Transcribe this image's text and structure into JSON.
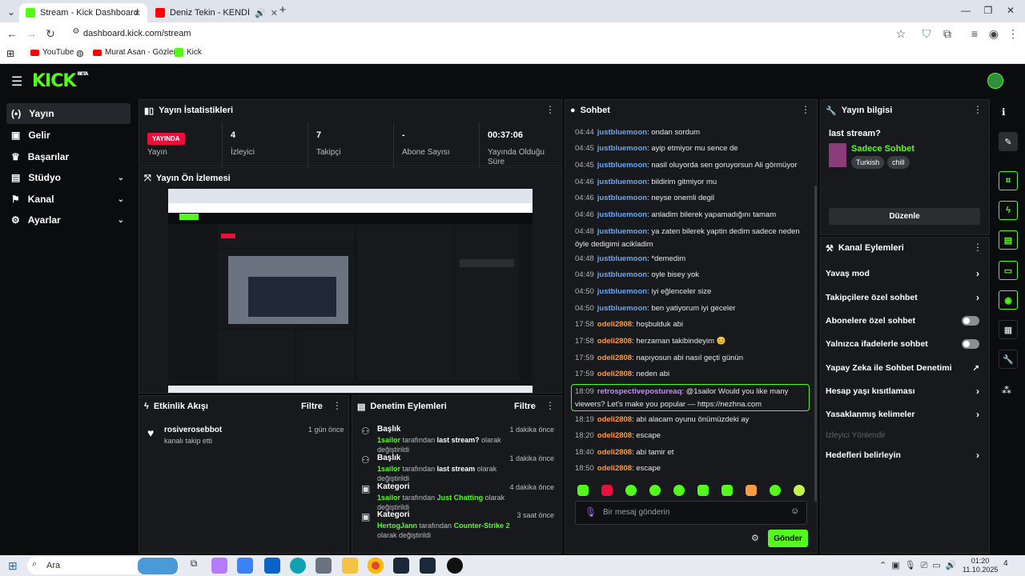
{
  "browser": {
    "tabs": [
      {
        "label": "Stream - Kick Dashboard"
      },
      {
        "label": "Deniz Tekin - KENDİNE İYİ B..."
      }
    ],
    "url": "dashboard.kick.com/stream",
    "bookmarks": [
      "YouTube",
      "Murat Asan - Gözler...",
      "Kick"
    ]
  },
  "app": {
    "logo": "KICK",
    "logo_badge": "BETA"
  },
  "sidebar": {
    "items": [
      {
        "label": "Yayın",
        "icon": "broadcast-icon"
      },
      {
        "label": "Gelir",
        "icon": "wallet-icon"
      },
      {
        "label": "Başarılar",
        "icon": "trophy-icon"
      },
      {
        "label": "Stüdyo",
        "icon": "studio-icon"
      },
      {
        "label": "Kanal",
        "icon": "channel-icon"
      },
      {
        "label": "Ayarlar",
        "icon": "gear-icon"
      }
    ]
  },
  "stats": {
    "title": "Yayın İstatistikleri",
    "live_badge": "YAYINDA",
    "items": [
      {
        "value": "",
        "label": "Yayın"
      },
      {
        "value": "4",
        "label": "İzleyici"
      },
      {
        "value": "7",
        "label": "Takipçi"
      },
      {
        "value": "-",
        "label": "Abone Sayısı"
      },
      {
        "value": "00:37:06",
        "label": "Yayında Olduğu Süre"
      }
    ]
  },
  "preview": {
    "title": "Yayın Ön İzlemesi"
  },
  "activity": {
    "title": "Etkinlik Akışı",
    "filter": "Filtre",
    "items": [
      {
        "user": "rosiverosebbot",
        "text": "kanalı takip etti",
        "time": "1 gün önce"
      }
    ]
  },
  "mod": {
    "title": "Denetim Eylemleri",
    "filter": "Filtre",
    "items": [
      {
        "title": "Başlık",
        "user": "1sailor",
        "mid": "tarafından",
        "value": "last stream?",
        "tail": "olarak değiştirildi",
        "time": "1 dakika önce"
      },
      {
        "title": "Başlık",
        "user": "1sailor",
        "mid": "tarafından",
        "value": "last stream",
        "tail": "olarak değiştirildi",
        "time": "1 dakika önce"
      },
      {
        "title": "Kategori",
        "user": "1sailor",
        "mid": "tarafından",
        "value": "Just Chatting",
        "tail": "olarak değiştirildi",
        "time": "4 dakika önce"
      },
      {
        "title": "Kategori",
        "user": "HertogJann",
        "mid": "tarafından",
        "value": "Counter-Strike 2",
        "tail": "olarak değiştirildi",
        "time": "3 saat önce"
      }
    ]
  },
  "chat": {
    "title": "Sohbet",
    "placeholder": "Bir mesaj gönderin",
    "send": "Gönder",
    "messages": [
      {
        "time": "04:44",
        "user": "justbluemoon",
        "text": "ondan sordum",
        "color": "blue"
      },
      {
        "time": "04:45",
        "user": "justbluemoon",
        "text": "ayip etmiyor mu sence de",
        "color": "blue"
      },
      {
        "time": "04:45",
        "user": "justbluemoon",
        "text": "nasil oluyorda sen goruyorsun Ali görmüyor",
        "color": "blue"
      },
      {
        "time": "04:46",
        "user": "justbluemoon",
        "text": "bildirim gitmiyor mu",
        "color": "blue"
      },
      {
        "time": "04:46",
        "user": "justbluemoon",
        "text": "neyse onemli degil",
        "color": "blue"
      },
      {
        "time": "04:46",
        "user": "justbluemoon",
        "text": "anladim bilerek yapamadığını tamam",
        "color": "blue"
      },
      {
        "time": "04:48",
        "user": "justbluemoon",
        "text": "ya zaten bilerek yaptin dedim sadece neden öyle dedigimi acikladim",
        "color": "blue"
      },
      {
        "time": "04:48",
        "user": "justbluemoon",
        "text": "*demedim",
        "color": "blue"
      },
      {
        "time": "04:49",
        "user": "justbluemoon",
        "text": "oyle bisey yok",
        "color": "blue"
      },
      {
        "time": "04:50",
        "user": "justbluemoon",
        "text": "iyi eğlenceler size",
        "color": "blue"
      },
      {
        "time": "04:50",
        "user": "justbluemoon",
        "text": "ben yatiyorum iyi geceler",
        "color": "blue"
      },
      {
        "time": "17:58",
        "user": "odeli2808",
        "text": "hoşbulduk abi",
        "color": "orange"
      },
      {
        "time": "17:58",
        "user": "odeli2808",
        "text": "herzaman takibindeyim 😊",
        "color": "orange"
      },
      {
        "time": "17:59",
        "user": "odeli2808",
        "text": "napıyosun abi nasıl geçti günün",
        "color": "orange"
      },
      {
        "time": "17:59",
        "user": "odeli2808",
        "text": "neden abi",
        "color": "orange"
      },
      {
        "time": "18:09",
        "user": "retrospectivepostureaq",
        "text": "@1sailor Would you like many viewers? Let's make you popular — https://nezhna.com",
        "color": "purple"
      },
      {
        "time": "18:19",
        "user": "odeli2808",
        "text": "abi alacam oyunu önümüzdeki ay",
        "color": "orange"
      },
      {
        "time": "18:20",
        "user": "odeli2808",
        "text": "escape",
        "color": "orange"
      },
      {
        "time": "18:40",
        "user": "odeli2808",
        "text": "abi tamir et",
        "color": "orange"
      },
      {
        "time": "18:50",
        "user": "odeli2808",
        "text": "escape",
        "color": "orange"
      }
    ]
  },
  "streaminfo": {
    "title": "Yayın bilgisi",
    "stream_title": "last stream?",
    "category": "Sadece Sohbet",
    "tags": [
      "Turkish",
      "chill"
    ],
    "edit": "Düzenle"
  },
  "channel_actions": {
    "title": "Kanal Eylemleri",
    "items": [
      {
        "label": "Yavaş mod",
        "kind": "chevron"
      },
      {
        "label": "Takipçilere özel sohbet",
        "kind": "chevron"
      },
      {
        "label": "Abonelere özel sohbet",
        "kind": "toggle"
      },
      {
        "label": "Yalnızca ifadelerle sohbet",
        "kind": "toggle"
      },
      {
        "label": "Yapay Zeka ile Sohbet Denetimi",
        "kind": "external"
      },
      {
        "label": "Hesap yaşı kısıtlaması",
        "kind": "chevron"
      },
      {
        "label": "Yasaklanmış kelimeler",
        "kind": "chevron"
      },
      {
        "label": "İzleyici Yönlendir",
        "kind": "disabled"
      },
      {
        "label": "Hedefleri belirleyin",
        "kind": "chevron"
      }
    ]
  },
  "taskbar": {
    "search": "Ara",
    "time": "01:20",
    "date": "11.10.2025",
    "notif": "4"
  },
  "colors": {
    "accent": "#53fc18",
    "live": "#e9113c",
    "blue_user": "#63a9ff",
    "orange_user": "#ff9b3e",
    "purple_user": "#c58bff"
  }
}
